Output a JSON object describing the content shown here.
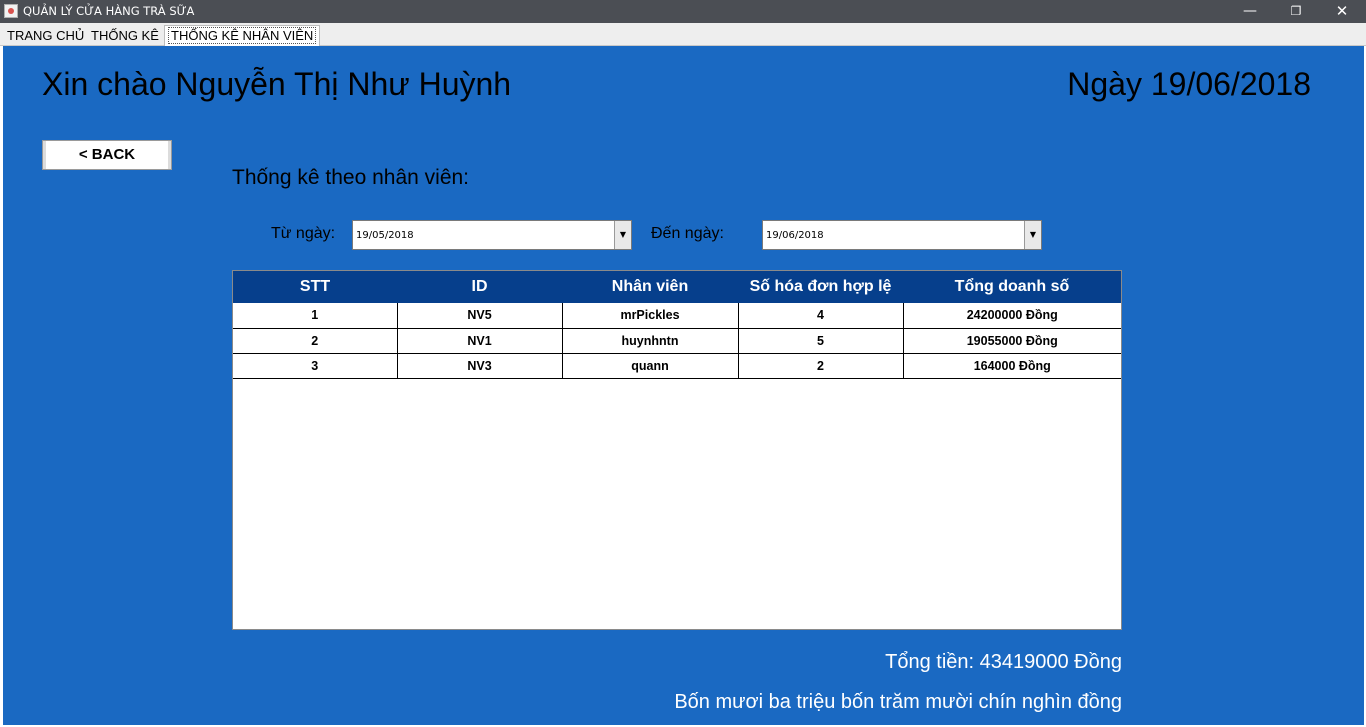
{
  "window": {
    "title": "QUẢN LÝ CỬA HÀNG TRÀ SỮA",
    "minimize_glyph": "—",
    "maximize_glyph": "❐",
    "close_glyph": "✕"
  },
  "tabs": [
    {
      "label": "TRANG CHỦ"
    },
    {
      "label": "THỐNG KÊ"
    },
    {
      "label": "THỐNG KÊ NHÂN VIÊN",
      "selected": true
    }
  ],
  "header": {
    "greeting": "Xin chào Nguyễn Thị Như Huỳnh",
    "date": "Ngày 19/06/2018"
  },
  "back_button": {
    "label": "< BACK"
  },
  "section_title": "Thống kê theo nhân viên:",
  "filters": {
    "from_label": "Từ ngày:",
    "from_value": "19/05/2018",
    "to_label": "Đến ngày:",
    "to_value": "19/06/2018",
    "dropdown_glyph": "▼"
  },
  "table": {
    "headers": [
      "STT",
      "ID",
      "Nhân viên",
      "Số hóa đơn hợp lệ",
      "Tổng doanh số"
    ],
    "rows": [
      [
        "1",
        "NV5",
        "mrPickles",
        "4",
        "24200000 Đồng"
      ],
      [
        "2",
        "NV1",
        "huynhntn",
        "5",
        "19055000 Đồng"
      ],
      [
        "3",
        "NV3",
        "quann",
        "2",
        "164000 Đồng"
      ]
    ]
  },
  "summary": {
    "total": "Tổng tiền: 43419000 Đồng",
    "total_words": "Bốn mươi ba triệu bốn trăm mười chín nghìn đồng"
  },
  "colors": {
    "panel_bg": "#1a69c2",
    "table_header_bg": "#063f8c",
    "titlebar_bg": "#4b4e54"
  }
}
